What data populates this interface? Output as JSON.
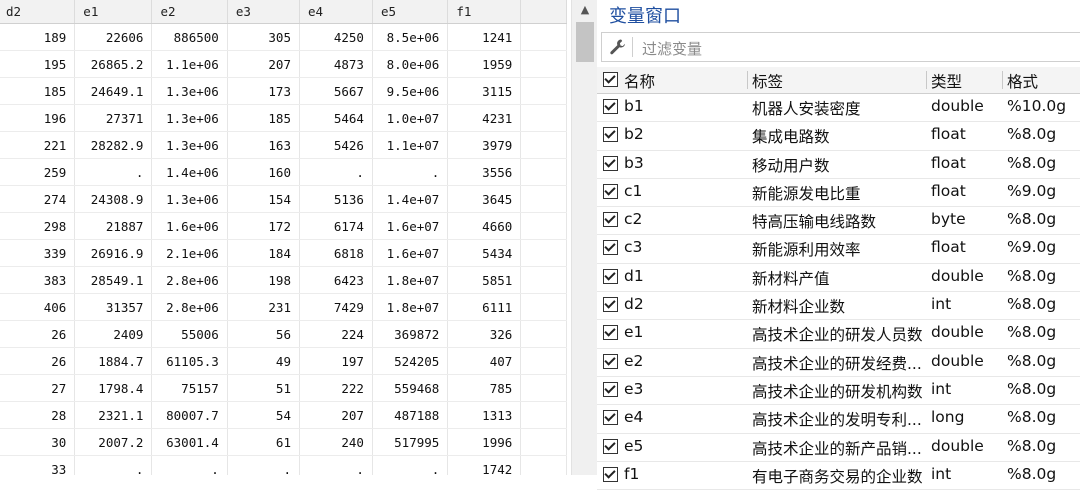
{
  "grid": {
    "columns": [
      "d2",
      "e1",
      "e2",
      "e3",
      "e4",
      "e5",
      "f1"
    ],
    "rows": [
      [
        "189",
        "22606",
        "886500",
        "305",
        "4250",
        "8.5e+06",
        "1241"
      ],
      [
        "195",
        "26865.2",
        "1.1e+06",
        "207",
        "4873",
        "8.0e+06",
        "1959"
      ],
      [
        "185",
        "24649.1",
        "1.3e+06",
        "173",
        "5667",
        "9.5e+06",
        "3115"
      ],
      [
        "196",
        "27371",
        "1.3e+06",
        "185",
        "5464",
        "1.0e+07",
        "4231"
      ],
      [
        "221",
        "28282.9",
        "1.3e+06",
        "163",
        "5426",
        "1.1e+07",
        "3979"
      ],
      [
        "259",
        ".",
        "1.4e+06",
        "160",
        ".",
        ".",
        "3556"
      ],
      [
        "274",
        "24308.9",
        "1.3e+06",
        "154",
        "5136",
        "1.4e+07",
        "3645"
      ],
      [
        "298",
        "21887",
        "1.6e+06",
        "172",
        "6174",
        "1.6e+07",
        "4660"
      ],
      [
        "339",
        "26916.9",
        "2.1e+06",
        "184",
        "6818",
        "1.6e+07",
        "5434"
      ],
      [
        "383",
        "28549.1",
        "2.8e+06",
        "198",
        "6423",
        "1.8e+07",
        "5851"
      ],
      [
        "406",
        "31357",
        "2.8e+06",
        "231",
        "7429",
        "1.8e+07",
        "6111"
      ],
      [
        "26",
        "2409",
        "55006",
        "56",
        "224",
        "369872",
        "326"
      ],
      [
        "26",
        "1884.7",
        "61105.3",
        "49",
        "197",
        "524205",
        "407"
      ],
      [
        "27",
        "1798.4",
        "75157",
        "51",
        "222",
        "559468",
        "785"
      ],
      [
        "28",
        "2321.1",
        "80007.7",
        "54",
        "207",
        "487188",
        "1313"
      ],
      [
        "30",
        "2007.2",
        "63001.4",
        "61",
        "240",
        "517995",
        "1996"
      ],
      [
        "33",
        ".",
        ".",
        ".",
        ".",
        ".",
        "1742"
      ]
    ]
  },
  "scrollbar": {
    "up_arrow": "▲"
  },
  "var_panel": {
    "title": "变量窗口",
    "filter_placeholder": "过滤变量",
    "headers": {
      "name": "名称",
      "label": "标签",
      "type": "类型",
      "format": "格式"
    },
    "variables": [
      {
        "name": "b1",
        "label": "机器人安装密度",
        "type": "double",
        "format": "%10.0g"
      },
      {
        "name": "b2",
        "label": "集成电路数",
        "type": "float",
        "format": "%8.0g"
      },
      {
        "name": "b3",
        "label": "移动用户数",
        "type": "float",
        "format": "%8.0g"
      },
      {
        "name": "c1",
        "label": "新能源发电比重",
        "type": "float",
        "format": "%9.0g"
      },
      {
        "name": "c2",
        "label": "特高压输电线路数",
        "type": "byte",
        "format": "%8.0g"
      },
      {
        "name": "c3",
        "label": "新能源利用效率",
        "type": "float",
        "format": "%9.0g"
      },
      {
        "name": "d1",
        "label": "新材料产值",
        "type": "double",
        "format": "%8.0g"
      },
      {
        "name": "d2",
        "label": "新材料企业数",
        "type": "int",
        "format": "%8.0g"
      },
      {
        "name": "e1",
        "label": "高技术企业的研发人员数",
        "type": "double",
        "format": "%8.0g"
      },
      {
        "name": "e2",
        "label": "高技术企业的研发经费...",
        "type": "double",
        "format": "%8.0g"
      },
      {
        "name": "e3",
        "label": "高技术企业的研发机构数",
        "type": "int",
        "format": "%8.0g"
      },
      {
        "name": "e4",
        "label": "高技术企业的发明专利...",
        "type": "long",
        "format": "%8.0g"
      },
      {
        "name": "e5",
        "label": "高技术企业的新产品销...",
        "type": "double",
        "format": "%8.0g"
      },
      {
        "name": "f1",
        "label": "有电子商务交易的企业数",
        "type": "int",
        "format": "%8.0g"
      }
    ]
  }
}
